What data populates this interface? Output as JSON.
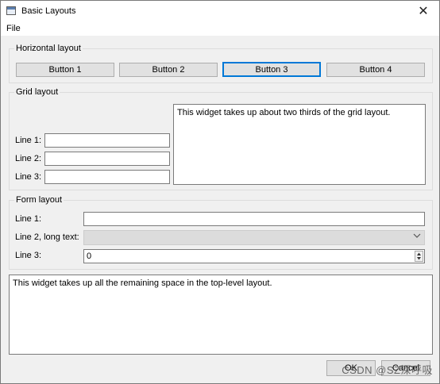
{
  "window": {
    "title": "Basic Layouts",
    "close_glyph": "✕"
  },
  "menubar": {
    "file_label": "File"
  },
  "horizontal_group": {
    "title": "Horizontal layout",
    "buttons": [
      "Button 1",
      "Button 2",
      "Button 3",
      "Button 4"
    ],
    "focused_button": "Button 3"
  },
  "grid_group": {
    "title": "Grid layout",
    "labels": [
      "Line 1:",
      "Line 2:",
      "Line 3:"
    ],
    "values": [
      "",
      "",
      ""
    ],
    "text_widget": "This widget takes up about two thirds of the grid layout."
  },
  "form_group": {
    "title": "Form layout",
    "line1_label": "Line 1:",
    "line1_value": "",
    "line2_label": "Line 2, long text:",
    "line2_value": "",
    "line3_label": "Line 3:",
    "line3_value": "0"
  },
  "bottom_text": "This widget takes up all the remaining space in the top-level layout.",
  "dialog_buttons": {
    "ok": "OK",
    "cancel": "Cancel"
  },
  "watermark": "CSDN @SZ深呼吸",
  "icons": {
    "app": "window-icon",
    "close": "close-icon",
    "dropdown": "chevron-down-icon",
    "spin_up": "arrow-up-icon",
    "spin_down": "arrow-down-icon"
  },
  "colors": {
    "window_bg": "#f0f0f0",
    "focus_border": "#0078d7",
    "button_bg": "#e1e1e1"
  }
}
